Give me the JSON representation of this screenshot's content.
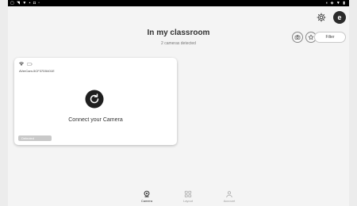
{
  "statusbar": {
    "left_icons": "▢ ◥ ▼ ▪ ◘ ▫",
    "right_icons": "◖ ◈ ▼ ▮"
  },
  "header": {
    "title": "In my classroom",
    "subtitle": "2 cameras detected",
    "filter_label": "Filter",
    "avatar_initial": "e"
  },
  "card": {
    "device_id": "AVerCam-5CF37D5401E",
    "connect_label": "Connect your Camera",
    "badge_label": "Detected"
  },
  "bottom_nav": {
    "items": [
      {
        "label": "Camera",
        "icon": "camera-icon",
        "active": true
      },
      {
        "label": "Layout",
        "icon": "grid-icon",
        "active": false
      },
      {
        "label": "Account",
        "icon": "person-icon",
        "active": false
      }
    ]
  },
  "colors": {
    "background": "#f4f4f4",
    "card": "#ffffff",
    "accent_dark": "#2b2b2b",
    "badge": "#c9c9c9"
  }
}
